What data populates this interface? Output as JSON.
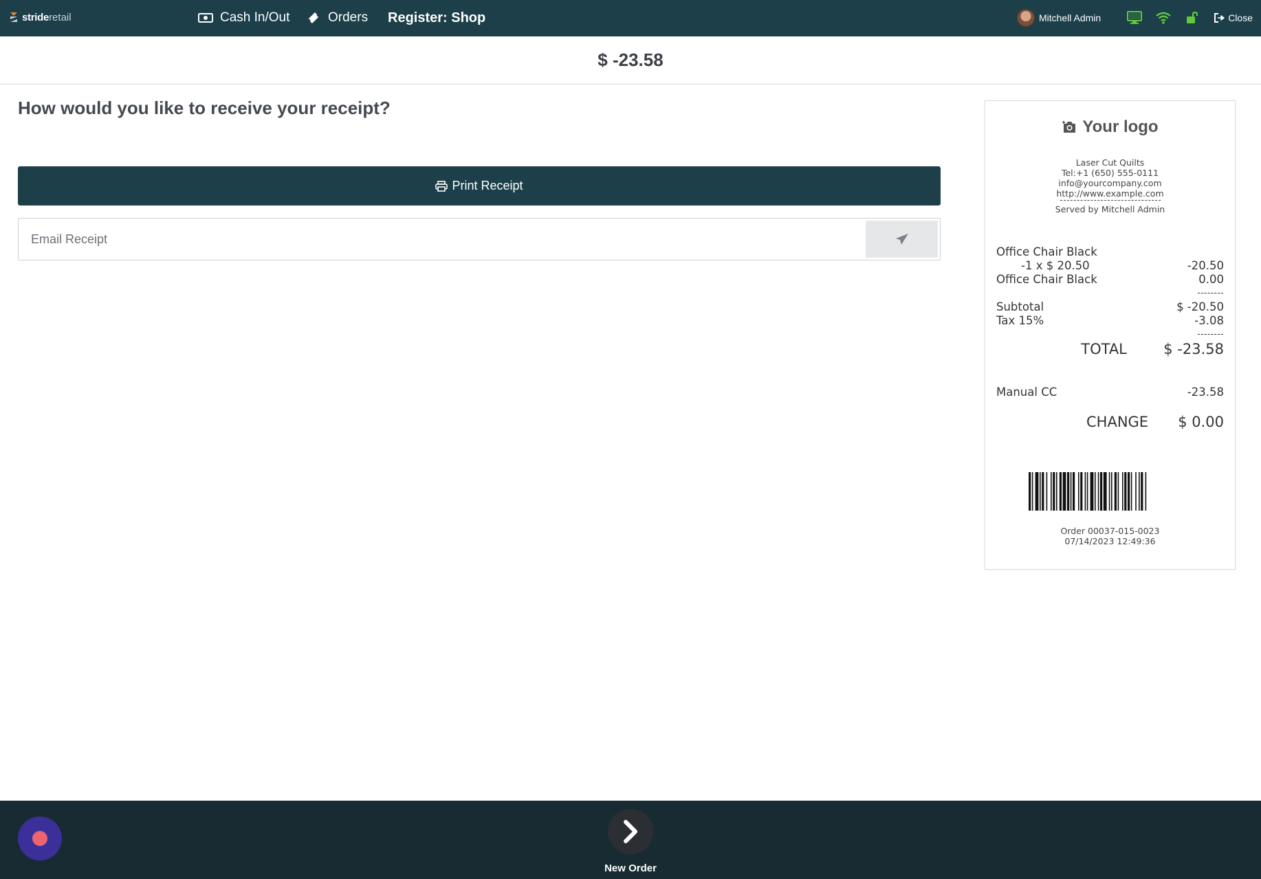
{
  "header": {
    "brand_bold": "stride",
    "brand_light": "retail",
    "cash_label": "Cash In/Out",
    "orders_label": "Orders",
    "register_label": "Register: Shop",
    "user_name": "Mitchell Admin",
    "close_label": "Close",
    "status_colors": {
      "display": "#5fcb3a",
      "wifi": "#5fcb3a",
      "lock": "#5fcb3a"
    }
  },
  "amount_due": "$ -23.58",
  "main": {
    "question": "How would you like to receive your receipt?",
    "print_label": "Print Receipt",
    "email_placeholder": "Email Receipt"
  },
  "receipt": {
    "logo_text": "Your logo",
    "company_name": "Laser Cut Quilts",
    "tel": "Tel:+1 (650) 555-0111",
    "email": "info@yourcompany.com",
    "website": "http://www.example.com",
    "served_by": "Served by Mitchell Admin",
    "lines": [
      {
        "name": "Office Chair Black",
        "value": ""
      },
      {
        "name": "-1 x $ 20.50",
        "value": "-20.50"
      },
      {
        "name": "Office Chair Black",
        "value": "0.00"
      }
    ],
    "dash": "--------",
    "subtotal_label": "Subtotal",
    "subtotal_value": "$ -20.50",
    "tax_label": "Tax 15%",
    "tax_value": "-3.08",
    "total_label": "TOTAL",
    "total_value": "$ -23.58",
    "payment_label": "Manual CC",
    "payment_value": "-23.58",
    "change_label": "CHANGE",
    "change_value": "$ 0.00",
    "order_ref": "Order 00037-015-0023",
    "order_date": "07/14/2023 12:49:36"
  },
  "footer": {
    "new_order_label": "New Order"
  },
  "icons": {
    "cash": "money-icon",
    "orders": "ticket-icon",
    "print": "printer-icon",
    "send": "paper-plane-icon",
    "logo": "camera-icon",
    "next": "chevron-right-icon"
  }
}
